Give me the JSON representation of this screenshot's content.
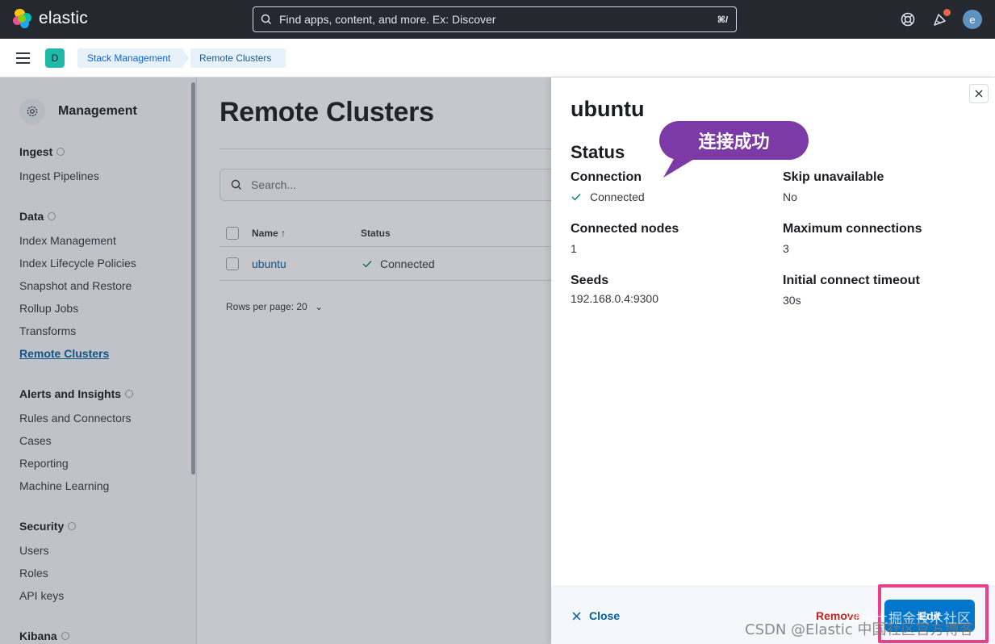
{
  "header": {
    "logo_text": "elastic",
    "search_placeholder": "Find apps, content, and more. Ex: Discover",
    "search_shortcut": "⌘/",
    "avatar_initial": "e",
    "icons": [
      "help-icon",
      "newsfeed-icon"
    ]
  },
  "breadcrumbs": {
    "space_initial": "D",
    "items": [
      "Stack Management",
      "Remote Clusters"
    ]
  },
  "sidebar": {
    "title": "Management",
    "groups": [
      {
        "label": "Ingest",
        "items": [
          "Ingest Pipelines"
        ]
      },
      {
        "label": "Data",
        "items": [
          "Index Management",
          "Index Lifecycle Policies",
          "Snapshot and Restore",
          "Rollup Jobs",
          "Transforms",
          "Remote Clusters"
        ]
      },
      {
        "label": "Alerts and Insights",
        "items": [
          "Rules and Connectors",
          "Cases",
          "Reporting",
          "Machine Learning"
        ]
      },
      {
        "label": "Security",
        "items": [
          "Users",
          "Roles",
          "API keys"
        ]
      },
      {
        "label": "Kibana",
        "items": []
      }
    ],
    "active_item": "Remote Clusters"
  },
  "main": {
    "title": "Remote Clusters",
    "search_placeholder": "Search...",
    "columns": [
      "Name",
      "Status"
    ],
    "rows": [
      {
        "name": "ubuntu",
        "status": "Connected"
      }
    ],
    "rows_per_page": "Rows per page: 20"
  },
  "flyout": {
    "title": "ubuntu",
    "section_title": "Status",
    "fields": {
      "connection_label": "Connection",
      "connection_value": "Connected",
      "skip_label": "Skip unavailable",
      "skip_value": "No",
      "nodes_label": "Connected nodes",
      "nodes_value": "1",
      "max_label": "Maximum connections",
      "max_value": "3",
      "seeds_label": "Seeds",
      "seeds_value": "192.168.0.4:9300",
      "timeout_label": "Initial connect timeout",
      "timeout_value": "30s"
    },
    "footer": {
      "close_label": "Close",
      "remove_label": "Remove",
      "edit_label": "Edit"
    }
  },
  "annotation": {
    "callout_text": "连接成功",
    "callout_color": "#7b3aa6",
    "highlight_color": "#e8418a"
  },
  "watermark": {
    "line1": "CSDN @Elastic 中国社区官方博客",
    "line2": "@稀土掘金技术社区"
  },
  "colors": {
    "header_bg": "#25282f",
    "link": "#0061a6",
    "success": "#017d73",
    "danger": "#bd271e",
    "primary_button": "#0077cc"
  }
}
